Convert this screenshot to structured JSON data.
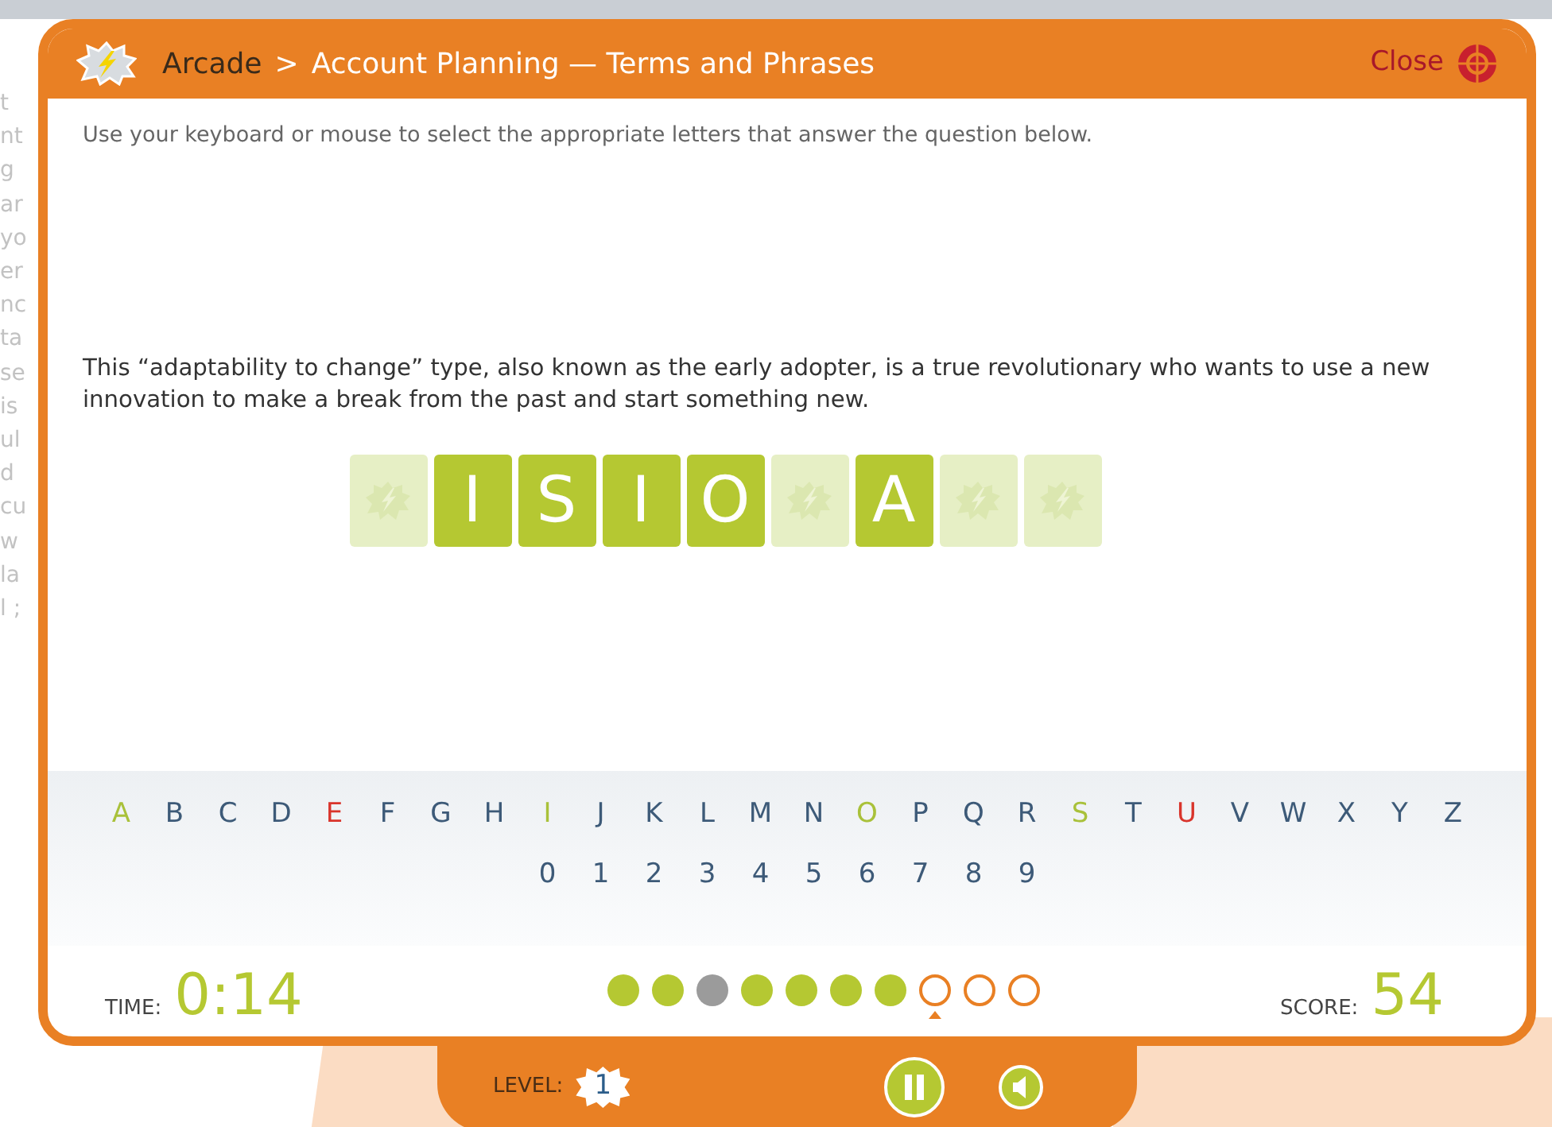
{
  "background_fragments": [
    "t",
    "nt",
    "g",
    "ar",
    "yo",
    "er",
    "nc",
    "ta",
    "se",
    "is",
    "ul",
    "d",
    "cu",
    "w",
    "la",
    "l ;"
  ],
  "header": {
    "breadcrumb": [
      "Arcade",
      "Account Planning — Terms and Phrases"
    ],
    "separator": ">",
    "close_label": "Close"
  },
  "instructions": "Use your keyboard or mouse to select the appropriate letters that answer the question below.",
  "question": "This “adaptability to change” type, also known as the early adopter, is a true revolutionary who wants to use a new innovation to make a break from the past and start something new.",
  "tiles": [
    {
      "revealed": false
    },
    {
      "letter": "I",
      "revealed": true
    },
    {
      "letter": "S",
      "revealed": true
    },
    {
      "letter": "I",
      "revealed": true
    },
    {
      "letter": "O",
      "revealed": true
    },
    {
      "revealed": false
    },
    {
      "letter": "A",
      "revealed": true
    },
    {
      "revealed": false
    },
    {
      "revealed": false
    }
  ],
  "letters": [
    {
      "char": "A",
      "kind": "hit"
    },
    {
      "char": "B",
      "kind": "open"
    },
    {
      "char": "C",
      "kind": "open"
    },
    {
      "char": "D",
      "kind": "open"
    },
    {
      "char": "E",
      "kind": "miss"
    },
    {
      "char": "F",
      "kind": "open"
    },
    {
      "char": "G",
      "kind": "open"
    },
    {
      "char": "H",
      "kind": "open"
    },
    {
      "char": "I",
      "kind": "hit"
    },
    {
      "char": "J",
      "kind": "open"
    },
    {
      "char": "K",
      "kind": "open"
    },
    {
      "char": "L",
      "kind": "open"
    },
    {
      "char": "M",
      "kind": "open"
    },
    {
      "char": "N",
      "kind": "open"
    },
    {
      "char": "O",
      "kind": "hit"
    },
    {
      "char": "P",
      "kind": "open"
    },
    {
      "char": "Q",
      "kind": "open"
    },
    {
      "char": "R",
      "kind": "open"
    },
    {
      "char": "S",
      "kind": "hit"
    },
    {
      "char": "T",
      "kind": "open"
    },
    {
      "char": "U",
      "kind": "miss"
    },
    {
      "char": "V",
      "kind": "open"
    },
    {
      "char": "W",
      "kind": "open"
    },
    {
      "char": "X",
      "kind": "open"
    },
    {
      "char": "Y",
      "kind": "open"
    },
    {
      "char": "Z",
      "kind": "open"
    }
  ],
  "digits": [
    {
      "char": "0",
      "kind": "open"
    },
    {
      "char": "1",
      "kind": "open"
    },
    {
      "char": "2",
      "kind": "open"
    },
    {
      "char": "3",
      "kind": "open"
    },
    {
      "char": "4",
      "kind": "open"
    },
    {
      "char": "5",
      "kind": "open"
    },
    {
      "char": "6",
      "kind": "open"
    },
    {
      "char": "7",
      "kind": "open"
    },
    {
      "char": "8",
      "kind": "open"
    },
    {
      "char": "9",
      "kind": "open"
    }
  ],
  "time": {
    "label": "TIME:",
    "value": "0:14"
  },
  "progress": [
    {
      "kind": "done"
    },
    {
      "kind": "done"
    },
    {
      "kind": "skipped"
    },
    {
      "kind": "done"
    },
    {
      "kind": "done"
    },
    {
      "kind": "done"
    },
    {
      "kind": "done"
    },
    {
      "kind": "current"
    },
    {
      "kind": "pending"
    },
    {
      "kind": "pending"
    }
  ],
  "score": {
    "label": "SCORE:",
    "value": "54"
  },
  "level": {
    "label": "LEVEL:",
    "value": "1"
  }
}
